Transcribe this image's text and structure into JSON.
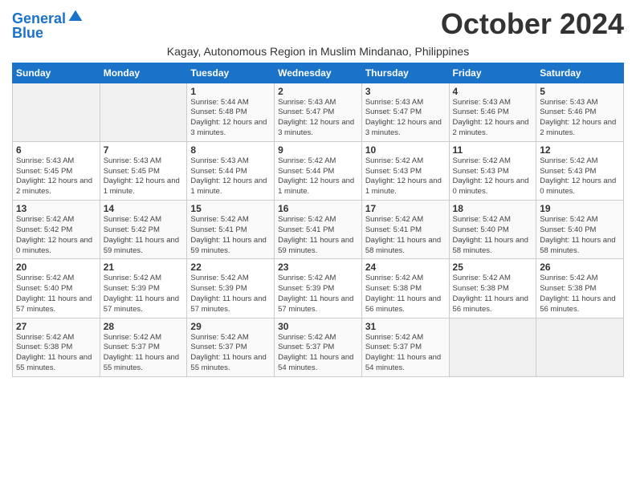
{
  "logo": {
    "line1": "General",
    "line2": "Blue"
  },
  "title": "October 2024",
  "subtitle": "Kagay, Autonomous Region in Muslim Mindanao, Philippines",
  "days_of_week": [
    "Sunday",
    "Monday",
    "Tuesday",
    "Wednesday",
    "Thursday",
    "Friday",
    "Saturday"
  ],
  "weeks": [
    [
      {
        "day": "",
        "sunrise": "",
        "sunset": "",
        "daylight": "",
        "empty": true
      },
      {
        "day": "",
        "sunrise": "",
        "sunset": "",
        "daylight": "",
        "empty": true
      },
      {
        "day": "1",
        "sunrise": "Sunrise: 5:44 AM",
        "sunset": "Sunset: 5:48 PM",
        "daylight": "Daylight: 12 hours and 3 minutes."
      },
      {
        "day": "2",
        "sunrise": "Sunrise: 5:43 AM",
        "sunset": "Sunset: 5:47 PM",
        "daylight": "Daylight: 12 hours and 3 minutes."
      },
      {
        "day": "3",
        "sunrise": "Sunrise: 5:43 AM",
        "sunset": "Sunset: 5:47 PM",
        "daylight": "Daylight: 12 hours and 3 minutes."
      },
      {
        "day": "4",
        "sunrise": "Sunrise: 5:43 AM",
        "sunset": "Sunset: 5:46 PM",
        "daylight": "Daylight: 12 hours and 2 minutes."
      },
      {
        "day": "5",
        "sunrise": "Sunrise: 5:43 AM",
        "sunset": "Sunset: 5:46 PM",
        "daylight": "Daylight: 12 hours and 2 minutes."
      }
    ],
    [
      {
        "day": "6",
        "sunrise": "Sunrise: 5:43 AM",
        "sunset": "Sunset: 5:45 PM",
        "daylight": "Daylight: 12 hours and 2 minutes."
      },
      {
        "day": "7",
        "sunrise": "Sunrise: 5:43 AM",
        "sunset": "Sunset: 5:45 PM",
        "daylight": "Daylight: 12 hours and 1 minute."
      },
      {
        "day": "8",
        "sunrise": "Sunrise: 5:43 AM",
        "sunset": "Sunset: 5:44 PM",
        "daylight": "Daylight: 12 hours and 1 minute."
      },
      {
        "day": "9",
        "sunrise": "Sunrise: 5:42 AM",
        "sunset": "Sunset: 5:44 PM",
        "daylight": "Daylight: 12 hours and 1 minute."
      },
      {
        "day": "10",
        "sunrise": "Sunrise: 5:42 AM",
        "sunset": "Sunset: 5:43 PM",
        "daylight": "Daylight: 12 hours and 1 minute."
      },
      {
        "day": "11",
        "sunrise": "Sunrise: 5:42 AM",
        "sunset": "Sunset: 5:43 PM",
        "daylight": "Daylight: 12 hours and 0 minutes."
      },
      {
        "day": "12",
        "sunrise": "Sunrise: 5:42 AM",
        "sunset": "Sunset: 5:43 PM",
        "daylight": "Daylight: 12 hours and 0 minutes."
      }
    ],
    [
      {
        "day": "13",
        "sunrise": "Sunrise: 5:42 AM",
        "sunset": "Sunset: 5:42 PM",
        "daylight": "Daylight: 12 hours and 0 minutes."
      },
      {
        "day": "14",
        "sunrise": "Sunrise: 5:42 AM",
        "sunset": "Sunset: 5:42 PM",
        "daylight": "Daylight: 11 hours and 59 minutes."
      },
      {
        "day": "15",
        "sunrise": "Sunrise: 5:42 AM",
        "sunset": "Sunset: 5:41 PM",
        "daylight": "Daylight: 11 hours and 59 minutes."
      },
      {
        "day": "16",
        "sunrise": "Sunrise: 5:42 AM",
        "sunset": "Sunset: 5:41 PM",
        "daylight": "Daylight: 11 hours and 59 minutes."
      },
      {
        "day": "17",
        "sunrise": "Sunrise: 5:42 AM",
        "sunset": "Sunset: 5:41 PM",
        "daylight": "Daylight: 11 hours and 58 minutes."
      },
      {
        "day": "18",
        "sunrise": "Sunrise: 5:42 AM",
        "sunset": "Sunset: 5:40 PM",
        "daylight": "Daylight: 11 hours and 58 minutes."
      },
      {
        "day": "19",
        "sunrise": "Sunrise: 5:42 AM",
        "sunset": "Sunset: 5:40 PM",
        "daylight": "Daylight: 11 hours and 58 minutes."
      }
    ],
    [
      {
        "day": "20",
        "sunrise": "Sunrise: 5:42 AM",
        "sunset": "Sunset: 5:40 PM",
        "daylight": "Daylight: 11 hours and 57 minutes."
      },
      {
        "day": "21",
        "sunrise": "Sunrise: 5:42 AM",
        "sunset": "Sunset: 5:39 PM",
        "daylight": "Daylight: 11 hours and 57 minutes."
      },
      {
        "day": "22",
        "sunrise": "Sunrise: 5:42 AM",
        "sunset": "Sunset: 5:39 PM",
        "daylight": "Daylight: 11 hours and 57 minutes."
      },
      {
        "day": "23",
        "sunrise": "Sunrise: 5:42 AM",
        "sunset": "Sunset: 5:39 PM",
        "daylight": "Daylight: 11 hours and 57 minutes."
      },
      {
        "day": "24",
        "sunrise": "Sunrise: 5:42 AM",
        "sunset": "Sunset: 5:38 PM",
        "daylight": "Daylight: 11 hours and 56 minutes."
      },
      {
        "day": "25",
        "sunrise": "Sunrise: 5:42 AM",
        "sunset": "Sunset: 5:38 PM",
        "daylight": "Daylight: 11 hours and 56 minutes."
      },
      {
        "day": "26",
        "sunrise": "Sunrise: 5:42 AM",
        "sunset": "Sunset: 5:38 PM",
        "daylight": "Daylight: 11 hours and 56 minutes."
      }
    ],
    [
      {
        "day": "27",
        "sunrise": "Sunrise: 5:42 AM",
        "sunset": "Sunset: 5:38 PM",
        "daylight": "Daylight: 11 hours and 55 minutes."
      },
      {
        "day": "28",
        "sunrise": "Sunrise: 5:42 AM",
        "sunset": "Sunset: 5:37 PM",
        "daylight": "Daylight: 11 hours and 55 minutes."
      },
      {
        "day": "29",
        "sunrise": "Sunrise: 5:42 AM",
        "sunset": "Sunset: 5:37 PM",
        "daylight": "Daylight: 11 hours and 55 minutes."
      },
      {
        "day": "30",
        "sunrise": "Sunrise: 5:42 AM",
        "sunset": "Sunset: 5:37 PM",
        "daylight": "Daylight: 11 hours and 54 minutes."
      },
      {
        "day": "31",
        "sunrise": "Sunrise: 5:42 AM",
        "sunset": "Sunset: 5:37 PM",
        "daylight": "Daylight: 11 hours and 54 minutes."
      },
      {
        "day": "",
        "sunrise": "",
        "sunset": "",
        "daylight": "",
        "empty": true
      },
      {
        "day": "",
        "sunrise": "",
        "sunset": "",
        "daylight": "",
        "empty": true
      }
    ]
  ]
}
